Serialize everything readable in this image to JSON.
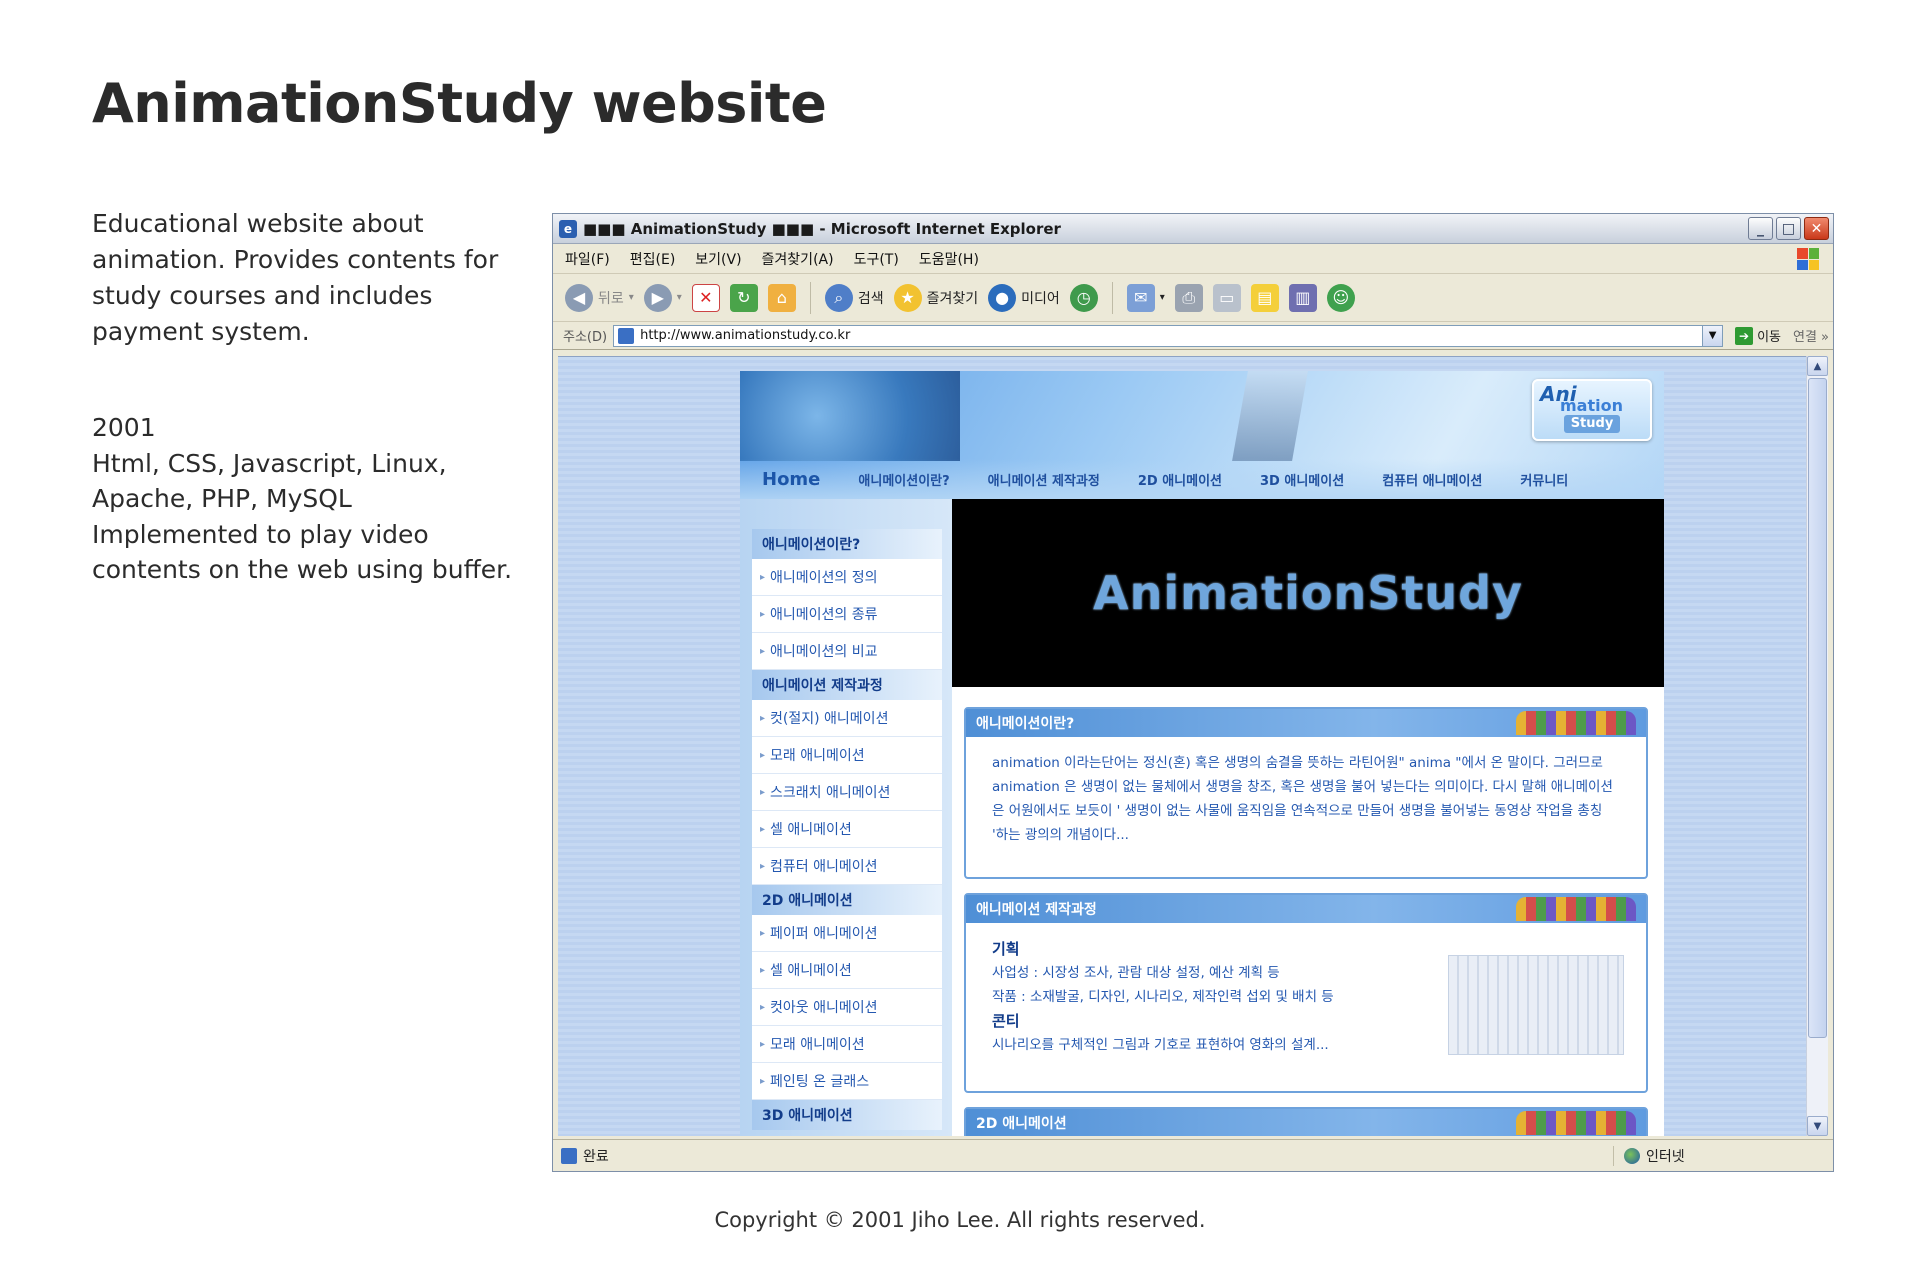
{
  "page": {
    "title": "AnimationStudy website",
    "description": "Educational website about animation. Provides contents for study courses and includes payment system.",
    "year": "2001",
    "tech": "Html, CSS, Javascript, Linux, Apache, PHP, MySQL",
    "note": "Implemented to play video contents on the web using buffer.",
    "copyright": "Copyright © 2001 Jiho Lee. All rights reserved."
  },
  "browser": {
    "title": "■■■ AnimationStudy ■■■ - Microsoft Internet Explorer",
    "menu": [
      "파일(F)",
      "편집(E)",
      "보기(V)",
      "즐겨찾기(A)",
      "도구(T)",
      "도움말(H)"
    ],
    "toolbar": {
      "back": "뒤로",
      "search": "검색",
      "favorites": "즐겨찾기",
      "media": "미디어"
    },
    "address_label": "주소(D)",
    "address_value": "http://www.animationstudy.co.kr",
    "go_label": "이동",
    "links_label": "연결",
    "status_text": "완료",
    "zone_text": "인터넷"
  },
  "site": {
    "logo": {
      "l1": "Ani",
      "l2": "mation",
      "l3": "Study"
    },
    "nav": [
      "Home",
      "애니메이션이란?",
      "애니메이션 제작과정",
      "2D 애니메이션",
      "3D 애니메이션",
      "컴퓨터 애니메이션",
      "커뮤니티"
    ],
    "sidebar": [
      {
        "category": "애니메이션이란?",
        "items": [
          "애니메이션의 정의",
          "애니메이션의 종류",
          "애니메이션의 비교"
        ]
      },
      {
        "category": "애니메이션 제작과정",
        "items": [
          "컷(절지) 애니메이션",
          "모래 애니메이션",
          "스크래치 애니메이션",
          "셀 애니메이션",
          "컴퓨터 애니메이션"
        ]
      },
      {
        "category": "2D 애니메이션",
        "items": [
          "페이퍼 애니메이션",
          "셀 애니메이션",
          "컷아웃 애니메이션",
          "모래 애니메이션",
          "페인팅 온 글래스"
        ]
      },
      {
        "category": "3D 애니메이션",
        "items": []
      }
    ],
    "hero": "AnimationStudy",
    "box1": {
      "title": "애니메이션이란?",
      "body": "animation 이라는단어는 정신(혼) 혹은 생명의 숨결을 뜻하는 라틴어원\" anima \"에서 온 말이다. 그러므로 animation 은 생명이 없는 물체에서 생명을 창조, 혹은 생명을 불어 넣는다는 의미이다. 다시 말해 애니메이션은 어원에서도 보듯이 ' 생명이 없는 사물에 움직임을 연속적으로 만들어 생명을 불어넣는 동영상 작업을 총칭 '하는 광의의 개념이다..."
    },
    "box2": {
      "title": "애니메이션 제작과정",
      "h1": "기획",
      "l1": "사업성 : 시장성 조사, 관람 대상 설정, 예산 계획 등",
      "l2": "작품 : 소재발굴, 디자인, 시나리오, 제작인력 섭외 및 배치 등",
      "h2": "콘티",
      "l3": "시나리오를 구체적인 그림과 기호로 표현하여 영화의 설계..."
    },
    "box3": {
      "title": "2D 애니메이션"
    }
  }
}
